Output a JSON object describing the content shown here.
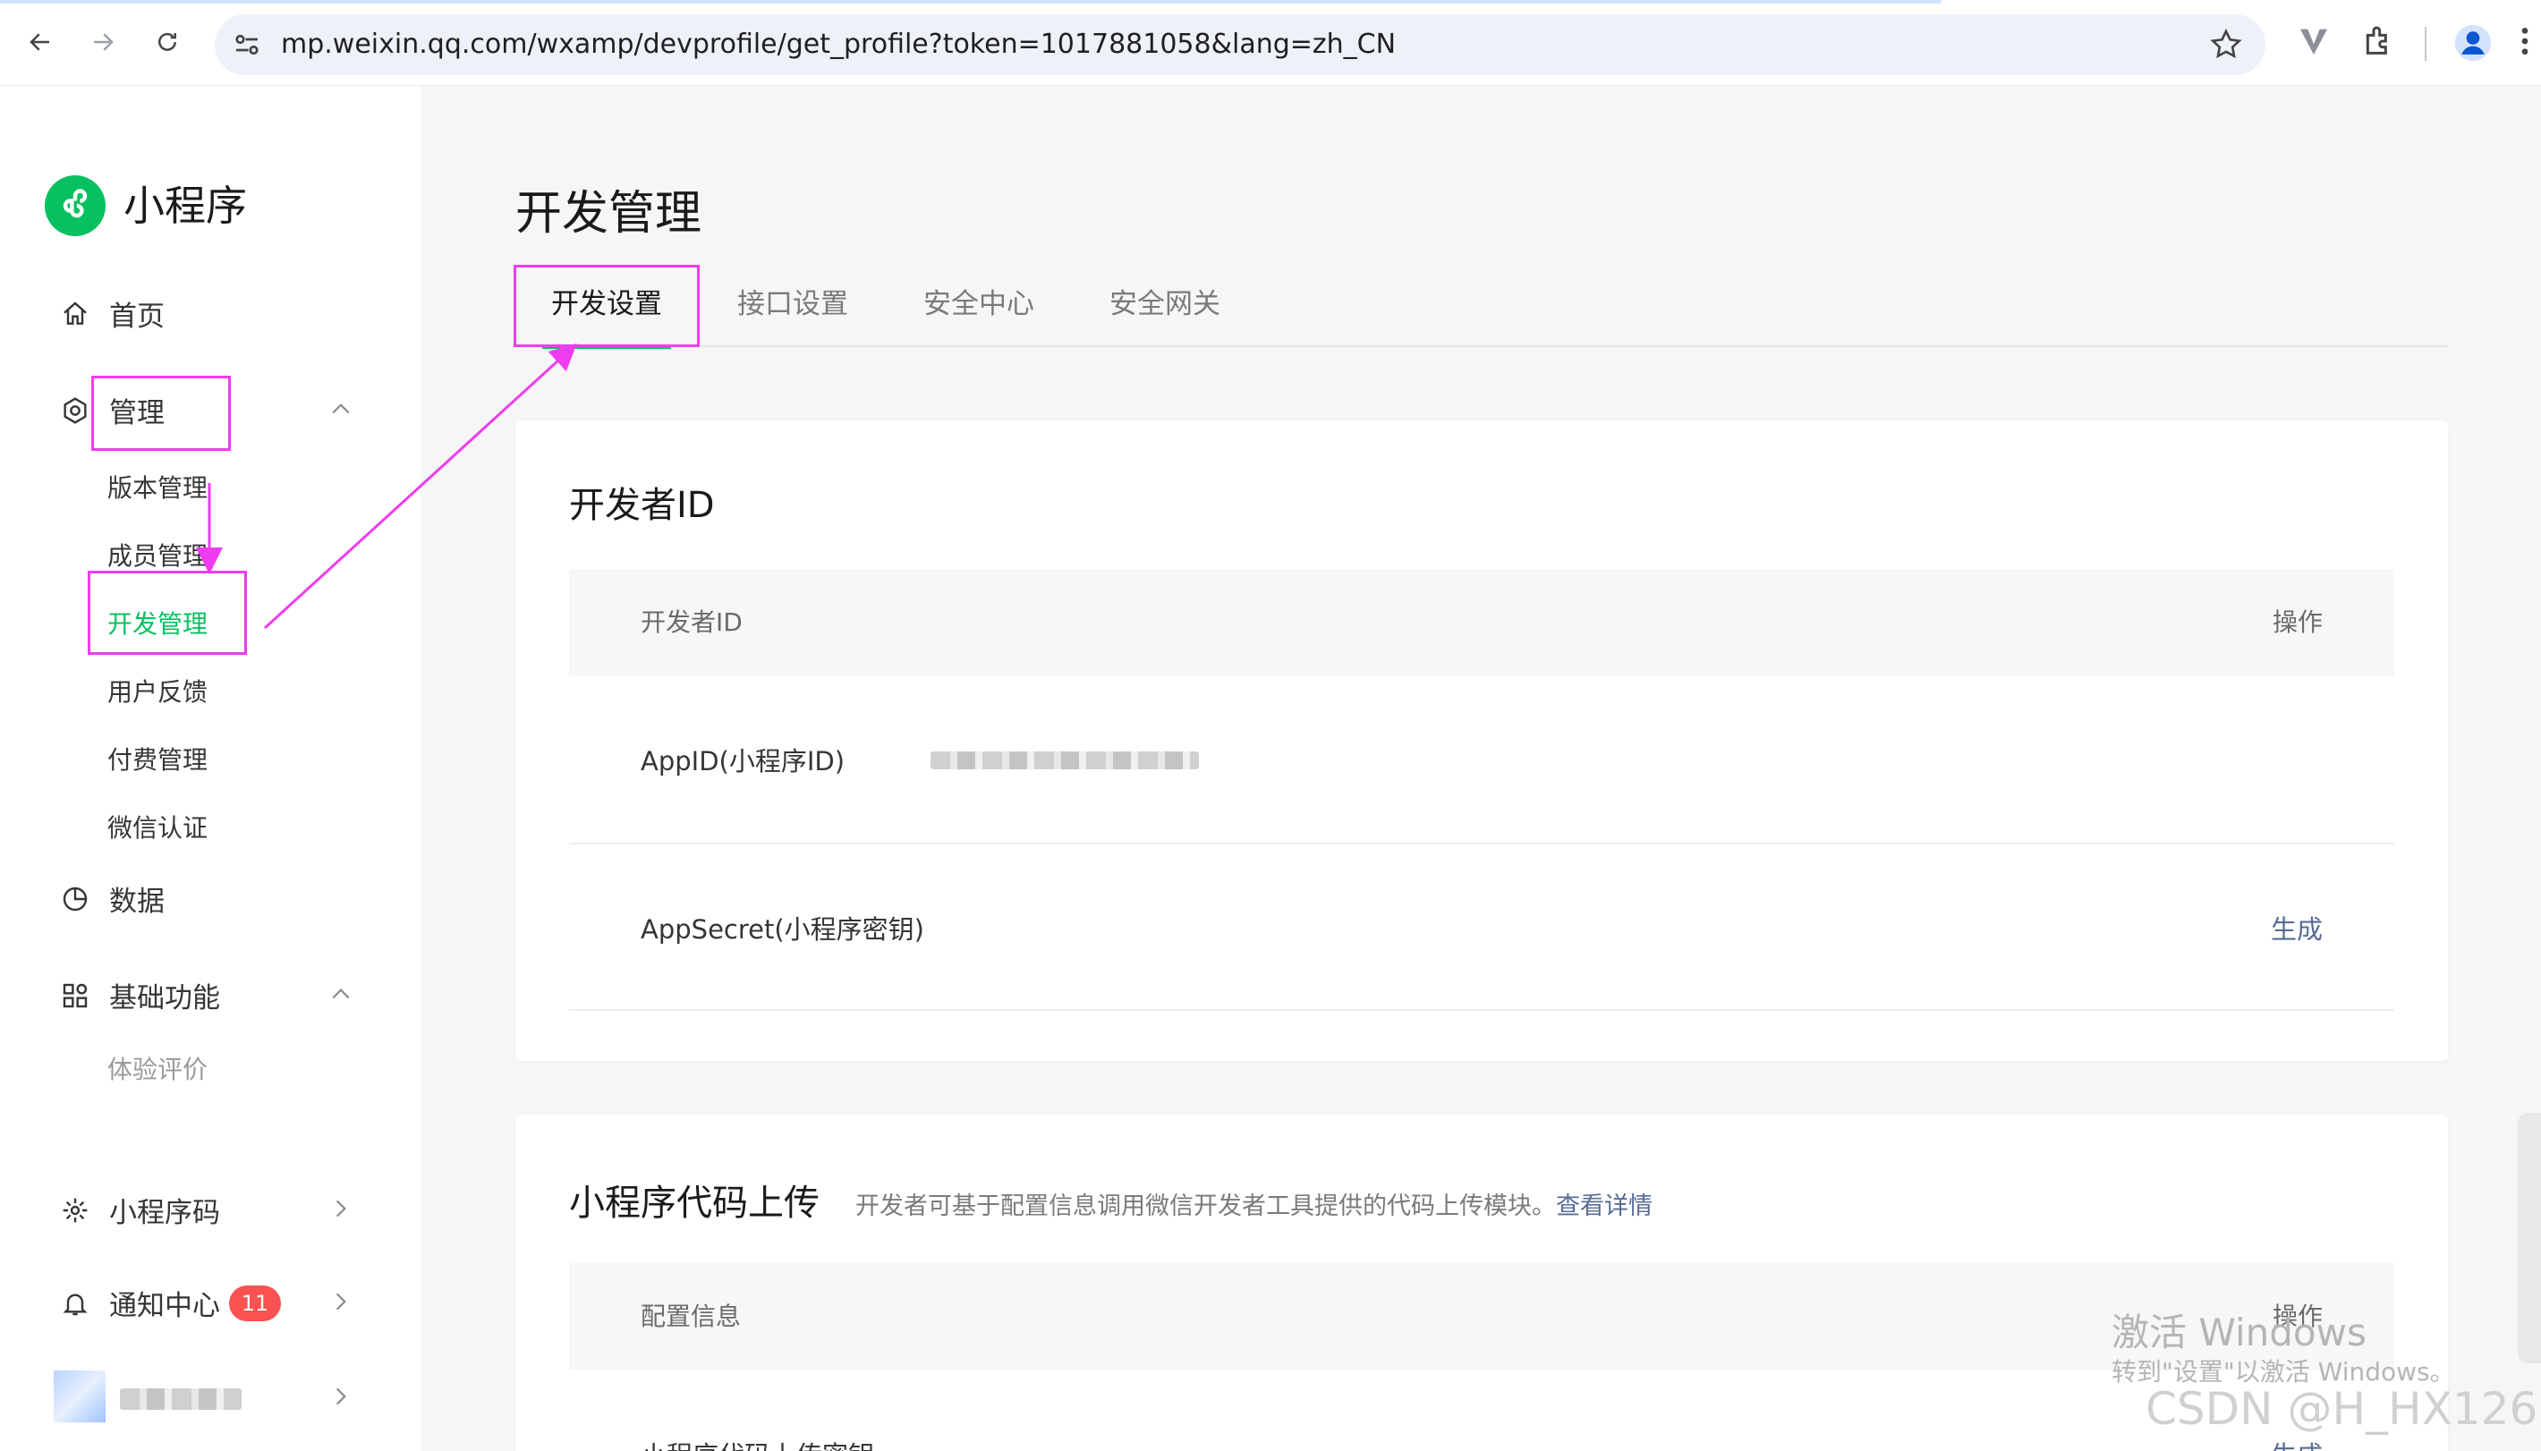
{
  "browser": {
    "url": "mp.weixin.qq.com/wxamp/devprofile/get_profile?token=1017881058&lang=zh_CN"
  },
  "sidebar": {
    "logo_text": "小程序",
    "home": "首页",
    "manage": "管理",
    "manage_items": [
      "版本管理",
      "成员管理",
      "开发管理",
      "用户反馈",
      "付费管理",
      "微信认证"
    ],
    "data": "数据",
    "basic": "基础功能",
    "basic_items": [
      "体验评价"
    ],
    "qrcode": "小程序码",
    "notify": "通知中心",
    "notify_count": "11"
  },
  "main": {
    "title": "开发管理",
    "tabs": [
      "开发设置",
      "接口设置",
      "安全中心",
      "安全网关"
    ],
    "dev_id": {
      "title": "开发者ID",
      "col_id": "开发者ID",
      "col_action": "操作",
      "appid_label": "AppID(小程序ID)",
      "secret_label": "AppSecret(小程序密钥)",
      "secret_action": "生成"
    },
    "upload": {
      "title": "小程序代码上传",
      "desc": "开发者可基于配置信息调用微信开发者工具提供的代码上传模块。",
      "desc_link": "查看详情",
      "col_config": "配置信息",
      "col_action": "操作",
      "row_label": "小程序代码上传密钥",
      "row_action": "生成"
    }
  },
  "watermark": {
    "line1": "激活 Windows",
    "line2": "转到\"设置\"以激活 Windows。",
    "csdn": "CSDN @H_HX126"
  },
  "colors": {
    "brand_green": "#07c160",
    "link_blue": "#576b95",
    "badge_red": "#fa5151",
    "annotation_magenta": "#f03cf0"
  }
}
